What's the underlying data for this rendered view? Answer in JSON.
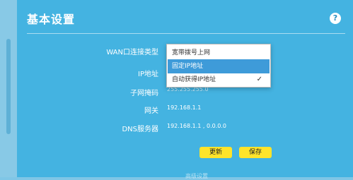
{
  "header": {
    "title": "基本设置",
    "help_icon_label": "?"
  },
  "form": {
    "wan_type_label": "WAN口连接类型",
    "ip_label": "IP地址",
    "subnet_label": "子网掩码",
    "subnet_value_partial": "255.255.255.0",
    "gateway_label": "网关",
    "gateway_value": "192.168.1.1",
    "dns_label": "DNS服务器",
    "dns_value": "192.168.1.1 , 0.0.0.0"
  },
  "dropdown": {
    "items": [
      {
        "label": "宽带拨号上网"
      },
      {
        "label": "固定IP地址",
        "state": "highlighted"
      },
      {
        "label": "自动获得IP地址",
        "state": "checked"
      }
    ],
    "check_mark": "✓"
  },
  "buttons": {
    "update_label": "更新",
    "save_label": "保存"
  },
  "footer": {
    "partial_text": "高级设置"
  },
  "colors": {
    "panel": "#44b3e1",
    "highlight": "#3e9bd9",
    "button": "#ffe42a"
  }
}
